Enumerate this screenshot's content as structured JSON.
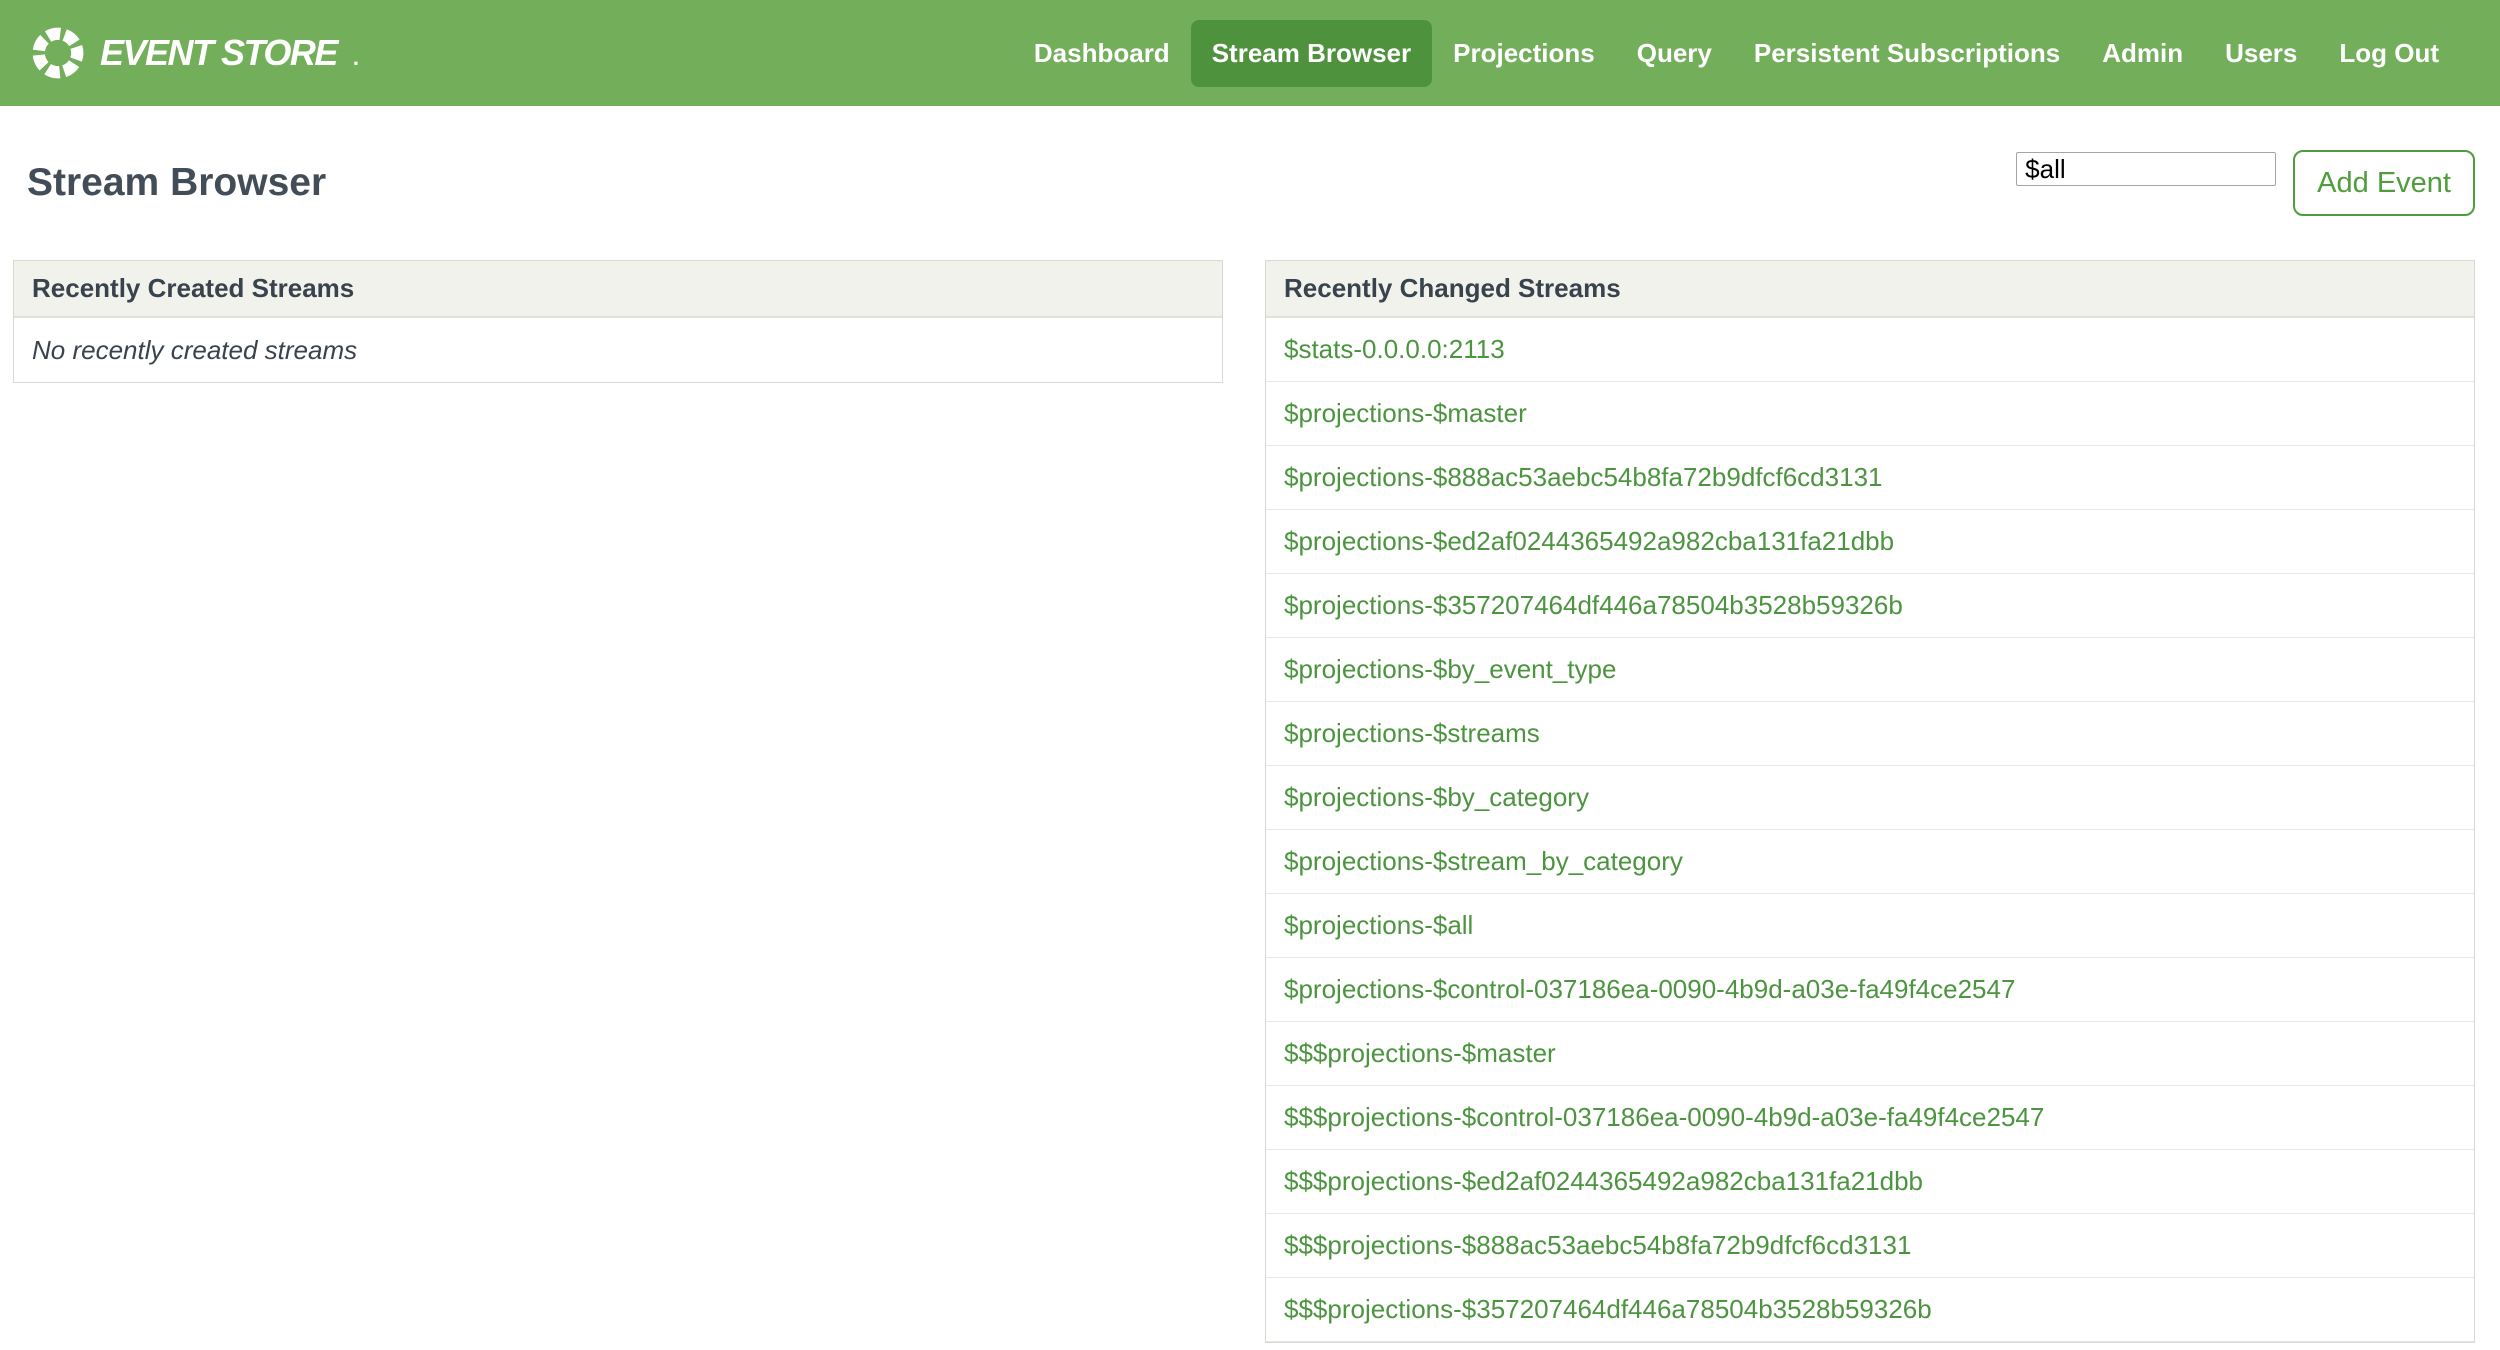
{
  "nav": {
    "brand_text": "EVENT STORE",
    "brand_suffix": ".",
    "items": [
      {
        "label": "Dashboard",
        "active": false
      },
      {
        "label": "Stream Browser",
        "active": true
      },
      {
        "label": "Projections",
        "active": false
      },
      {
        "label": "Query",
        "active": false
      },
      {
        "label": "Persistent Subscriptions",
        "active": false
      },
      {
        "label": "Admin",
        "active": false
      },
      {
        "label": "Users",
        "active": false
      },
      {
        "label": "Log Out",
        "active": false
      }
    ]
  },
  "page": {
    "title": "Stream Browser",
    "stream_input_value": "$all",
    "add_event_label": "Add Event"
  },
  "recently_created": {
    "title": "Recently Created Streams",
    "empty_message": "No recently created streams"
  },
  "recently_changed": {
    "title": "Recently Changed Streams",
    "streams": [
      "$stats-0.0.0.0:2113",
      "$projections-$master",
      "$projections-$888ac53aebc54b8fa72b9dfcf6cd3131",
      "$projections-$ed2af0244365492a982cba131fa21dbb",
      "$projections-$357207464df446a78504b3528b59326b",
      "$projections-$by_event_type",
      "$projections-$streams",
      "$projections-$by_category",
      "$projections-$stream_by_category",
      "$projections-$all",
      "$projections-$control-037186ea-0090-4b9d-a03e-fa49f4ce2547",
      "$$$projections-$master",
      "$$$projections-$control-037186ea-0090-4b9d-a03e-fa49f4ce2547",
      "$$$projections-$ed2af0244365492a982cba131fa21dbb",
      "$$$projections-$888ac53aebc54b8fa72b9dfcf6cd3131",
      "$$$projections-$357207464df446a78504b3528b59326b"
    ]
  },
  "colors": {
    "navbar_green": "#73ae5a",
    "active_nav_green": "#4e923d",
    "link_green": "#4c9440",
    "button_green": "#4f9d3d",
    "panel_header_bg": "#f1f2ec",
    "panel_border": "#d9d9d3",
    "heading_text": "#434d57"
  }
}
